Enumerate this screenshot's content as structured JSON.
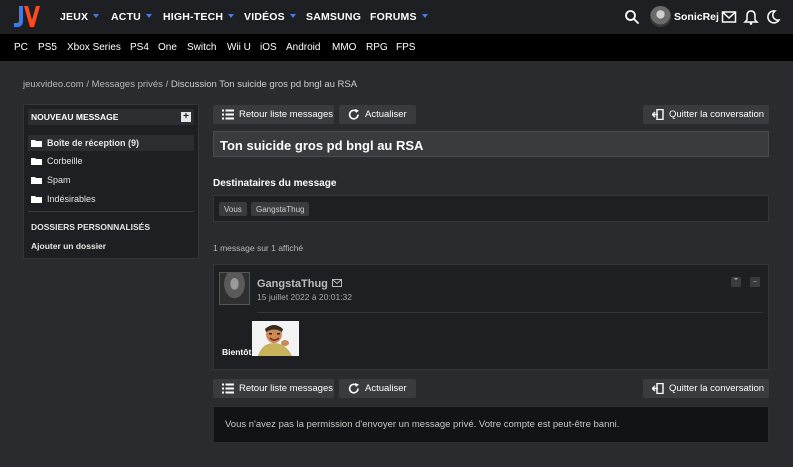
{
  "nav": {
    "items": [
      {
        "label": "JEUX",
        "dropdown": true
      },
      {
        "label": "ACTU",
        "dropdown": true
      },
      {
        "label": "HIGH-TECH",
        "dropdown": true
      },
      {
        "label": "VIDÉOS",
        "dropdown": true
      },
      {
        "label": "SAMSUNG",
        "dropdown": false
      },
      {
        "label": "FORUMS",
        "dropdown": true
      }
    ],
    "username": "SonicRej",
    "icons": [
      "search-icon",
      "mail-icon",
      "bell-icon",
      "moon-icon"
    ],
    "accent_color": "#4a7bd6"
  },
  "platforms": [
    "PC",
    "PS5",
    "Xbox Series",
    "PS4",
    "One",
    "Switch",
    "Wii U",
    "iOS",
    "Android",
    "MMO",
    "RPG",
    "FPS"
  ],
  "breadcrumb": {
    "part1": "jeuxvideo.com",
    "sep": " / ",
    "part2": "Messages privés",
    "part3": "Discussion Ton suicide gros pd bngl au RSA"
  },
  "sidebar": {
    "new_message": "NOUVEAU MESSAGE",
    "plus": "+",
    "folders": [
      {
        "label": "Boîte de réception (9)",
        "active": true
      },
      {
        "label": "Corbeille",
        "active": false
      },
      {
        "label": "Spam",
        "active": false
      },
      {
        "label": "Indésirables",
        "active": false
      }
    ],
    "custom_title": "DOSSIERS PERSONNALISÉS",
    "add_folder": "Ajouter un dossier"
  },
  "toolbar": {
    "back": "Retour liste messages",
    "refresh": "Actualiser",
    "quit": "Quitter la conversation"
  },
  "conversation": {
    "title": "Ton suicide gros pd bngl au RSA",
    "recipients_label": "Destinataires du message",
    "recipients": [
      "Vous",
      "GangstaThug"
    ],
    "count": "1 message sur 1 affiché"
  },
  "message": {
    "author": "GangstaThug",
    "date": "15 juillet 2022 à 20:01:32",
    "text": "Bientôt",
    "actions": [
      "quote-icon",
      "menu-icon"
    ]
  },
  "notice": "Vous n'avez pas la permission d'envoyer un message privé. Votre compte est peut-être banni."
}
